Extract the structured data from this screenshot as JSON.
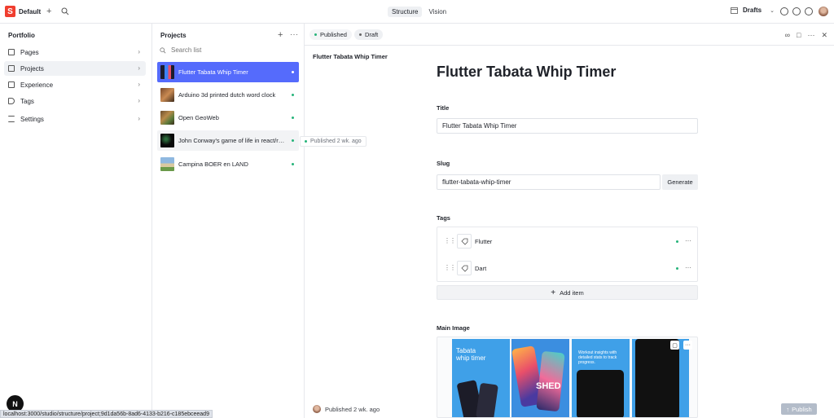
{
  "topbar": {
    "logo_letter": "S",
    "workspace": "Default",
    "tabs": [
      {
        "label": "Structure",
        "active": true
      },
      {
        "label": "Vision",
        "active": false
      }
    ],
    "perspective": "Drafts"
  },
  "sidebar": {
    "title": "Portfolio",
    "items": [
      {
        "label": "Pages",
        "icon": "document-icon"
      },
      {
        "label": "Projects",
        "icon": "document-icon",
        "active": true
      },
      {
        "label": "Experience",
        "icon": "document-icon"
      },
      {
        "label": "Tags",
        "icon": "tag-icon"
      },
      {
        "label": "Settings",
        "icon": "sliders-icon"
      }
    ]
  },
  "projects": {
    "title": "Projects",
    "search_placeholder": "Search list",
    "items": [
      {
        "title": "Flutter Tabata Whip Timer",
        "selected": true
      },
      {
        "title": "Arduino 3d printed dutch word clock"
      },
      {
        "title": "Open GeoWeb"
      },
      {
        "title": "John Conway's game of life in react/re..."
      },
      {
        "title": "Campina BOER en LAND"
      }
    ],
    "tooltip": "Published 2 wk. ago"
  },
  "document": {
    "status_published": "Published",
    "status_draft": "Draft",
    "breadcrumb_title": "Flutter Tabata Whip Timer",
    "heading": "Flutter Tabata Whip Timer",
    "title_label": "Title",
    "title_value": "Flutter Tabata Whip Timer",
    "slug_label": "Slug",
    "slug_value": "flutter-tabata-whip-timer",
    "generate_label": "Generate",
    "tags_label": "Tags",
    "tags": [
      {
        "label": "Flutter"
      },
      {
        "label": "Dart"
      }
    ],
    "add_item_label": "Add item",
    "main_image_label": "Main Image",
    "image_text_1": "Tabata whip timer",
    "image_text_2": "SHED",
    "image_text_3": "Workout insights with detailed stats to track progress.",
    "footer_status": "Published 2 wk. ago",
    "publish_label": "Publish"
  },
  "browser": {
    "status_url": "localhost:3000/studio/structure/project;9d1da56b-8ad6-4133-b216-c185ebceead9",
    "next_badge": "N"
  },
  "colors": {
    "accent": "#556bfc",
    "brand": "#f03e2f",
    "published_dot": "#27b47a"
  }
}
